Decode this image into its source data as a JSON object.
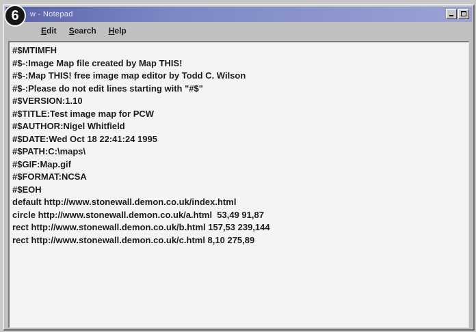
{
  "badge": {
    "number": "6"
  },
  "window": {
    "title": "w - Notepad"
  },
  "menu": [
    {
      "label": "Edit",
      "underline_index": 0
    },
    {
      "label": "Search",
      "underline_index": 0
    },
    {
      "label": "Help",
      "underline_index": 0
    }
  ],
  "document": {
    "lines": [
      "#$MTIMFH",
      "#$-:Image Map file created by Map THIS!",
      "#$-:Map THIS! free image map editor by Todd C. Wilson",
      "#$-:Please do not edit lines starting with \"#$\"",
      "#$VERSION:1.10",
      "#$TITLE:Test image map for PCW",
      "#$AUTHOR:Nigel Whitfield",
      "#$DATE:Wed Oct 18 22:41:24 1995",
      "#$PATH:C:\\maps\\",
      "#$GIF:Map.gif",
      "#$FORMAT:NCSA",
      "#$EOH",
      "default http://www.stonewall.demon.co.uk/index.html",
      "circle http://www.stonewall.demon.co.uk/a.html  53,49 91,87",
      "rect http://www.stonewall.demon.co.uk/b.html 157,53 239,144",
      "rect http://www.stonewall.demon.co.uk/c.html 8,10 275,89"
    ]
  }
}
